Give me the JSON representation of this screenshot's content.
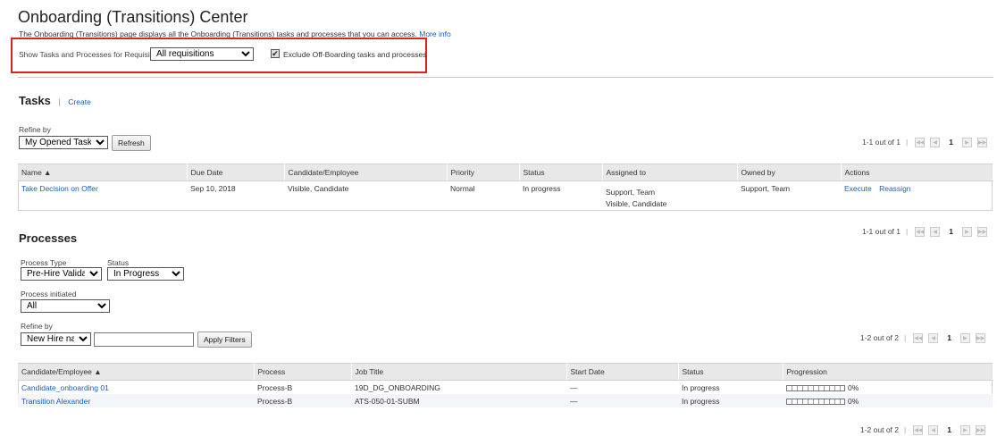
{
  "header": {
    "title": "Onboarding (Transitions) Center",
    "description": "The Onboarding (Transitions) page displays all the Onboarding (Transitions) tasks and processes that you can access.",
    "more_info": "More info"
  },
  "requisitions": {
    "label": "Show Tasks and Processes for Requisitions",
    "selected": "All requisitions",
    "exclude_checked": true,
    "exclude_label": "Exclude Off-Boarding tasks and processes"
  },
  "tasks": {
    "title": "Tasks",
    "separator": "|",
    "create": "Create",
    "refine_label": "Refine by",
    "refine_selected": "My Opened Tasks",
    "refresh": "Refresh",
    "pager": {
      "summary": "1-1 out of 1",
      "page": "1"
    },
    "columns": [
      "Name ▲",
      "Due Date",
      "Candidate/Employee",
      "Priority",
      "Status",
      "Assigned to",
      "Owned by",
      "Actions"
    ],
    "rows": [
      {
        "name": "Take Decision on Offer",
        "due": "Sep 10, 2018",
        "candidate": "Visible, Candidate",
        "priority": "Normal",
        "status": "In progress",
        "assigned1": "Support, Team",
        "assigned2": "Visible, Candidate",
        "owned": "Support, Team",
        "action1": "Execute",
        "action2": "Reassign"
      }
    ]
  },
  "processes": {
    "title": "Processes",
    "pager_top": {
      "summary": "1-1 out of 1",
      "page": "1"
    },
    "type_label": "Process Type",
    "type_selected": "Pre-Hire Validation",
    "status_label": "Status",
    "status_selected": "In Progress",
    "initiated_label": "Process initiated",
    "initiated_selected": "All",
    "refine_label": "Refine by",
    "refine_selected": "New Hire name",
    "refine_value": "",
    "apply": "Apply Filters",
    "pager": {
      "summary": "1-2 out of 2",
      "page": "1"
    },
    "pager_bottom": {
      "summary": "1-2 out of 2",
      "page": "1"
    },
    "columns": [
      "Candidate/Employee ▲",
      "Process",
      "Job Title",
      "Start Date",
      "Status",
      "Progression"
    ],
    "rows": [
      {
        "candidate": "Candidate_onboarding 01",
        "process": "Process-B",
        "job": "19D_DG_ONBOARDING",
        "start": "—",
        "status": "In progress",
        "progress": 0,
        "progress_label": "0%"
      },
      {
        "candidate": "Transition Alexander",
        "process": "Process-B",
        "job": "ATS-050-01-SUBM",
        "start": "—",
        "status": "In progress",
        "progress": 0,
        "progress_label": "0%"
      }
    ]
  },
  "colors": {
    "link": "#1a5fb4",
    "highlight": "#d9261c",
    "header_bg": "#e8e8e8"
  }
}
